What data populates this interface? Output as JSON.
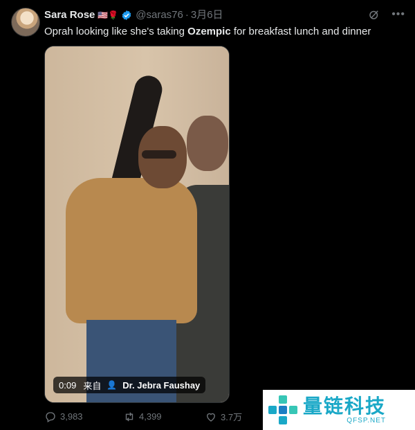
{
  "tweet": {
    "author_name": "Sara Rose",
    "flags": "🇺🇸🌹",
    "handle": "@saras76",
    "separator": "·",
    "date": "3月6日",
    "text_before": "Oprah looking like she's taking ",
    "text_bold": "Ozempic",
    "text_after": " for breakfast lunch and dinner"
  },
  "media": {
    "duration": "0:09",
    "from_label": "来自",
    "source_name": "Dr. Jebra Faushay"
  },
  "actions": {
    "replies": "3,983",
    "retweets": "4,399",
    "likes": "3.7万"
  },
  "watermark": {
    "title": "量链科技",
    "subtitle": "QFSP.NET"
  },
  "icons": {
    "verified": "verified-badge-icon",
    "grok": "grok-icon",
    "more": "more-icon",
    "reply": "reply-icon",
    "retweet": "retweet-icon",
    "like": "like-icon"
  },
  "colors": {
    "verified": "#1d9bf0",
    "muted": "#71767b",
    "watermark": "#1aa8c7"
  }
}
